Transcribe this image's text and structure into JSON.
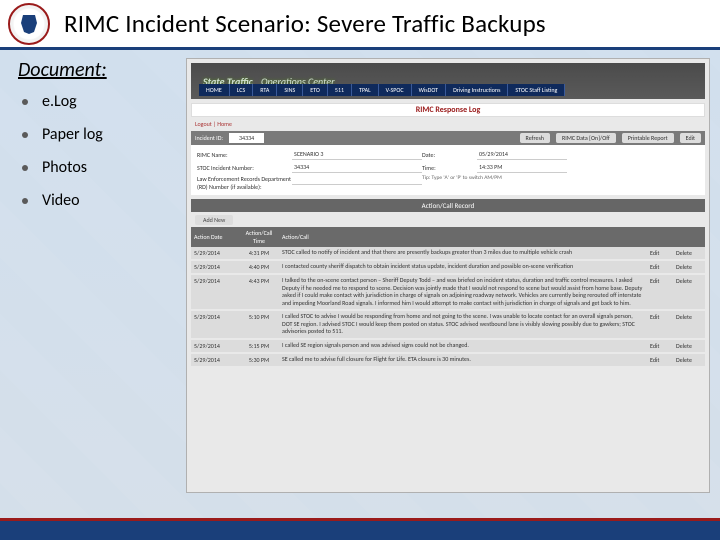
{
  "slide": {
    "title": "RIMC Incident Scenario: Severe Traffic Backups",
    "section": "Document:",
    "bullets": [
      "e.Log",
      "Paper log",
      "Photos",
      "Video"
    ]
  },
  "app": {
    "banner_main": "State Traffic",
    "banner_sub": "Operations Center",
    "nav": [
      "HOME",
      "LCS",
      "RTA",
      "SINS",
      "ETO",
      "511",
      "TPAL",
      "V-SPOC",
      "WisDOT",
      "Driving Instructions",
      "STOC Staff Listing"
    ],
    "response_label": "RIMC Response Log",
    "breadcrumb": "Logout | Home",
    "toolbar": {
      "incident_id_label": "Incident ID:",
      "incident_id": "34334",
      "refresh": "Refresh",
      "rimc_toggle": "RIMC Data [On]/Off",
      "printable": "Printable Report",
      "edit": "Edit"
    },
    "meta": {
      "rimc_name_label": "RIMC Name:",
      "rimc_name": "SCENARIO 3",
      "date_label": "Date:",
      "date": "05/29/2014",
      "stoc_label": "STOC Incident Number:",
      "stoc": "34334",
      "time_label": "Time:",
      "time": "14:33 PM",
      "le_label": "Law Enforcement Records Department (RD) Number (if available):",
      "le": "",
      "tip": "Tip: Type 'A' or 'P' to switch AM/PM"
    },
    "section_header": "Action/Call Record",
    "add_new": "Add New",
    "table": {
      "headers": [
        "Action Date",
        "Action/Call Time",
        "Action/Call",
        "",
        ""
      ],
      "rows": [
        {
          "date": "5/29/2014",
          "time": "4:31 PM",
          "text": "STOC called to notify of incident and that there are presently backups greater than 3 miles due to multiple vehicle crash",
          "a": "Edit",
          "b": "Delete"
        },
        {
          "date": "5/29/2014",
          "time": "4:40 PM",
          "text": "I contacted county sheriff dispatch to obtain incident status update, incident duration and possible on-scene verification",
          "a": "Edit",
          "b": "Delete"
        },
        {
          "date": "5/29/2014",
          "time": "4:43 PM",
          "text": "I talked to the on-scene contact person – Sheriff Deputy Todd – and was briefed on incident status, duration and traffic control measures. I asked Deputy if he needed me to respond to scene. Decision was jointly made that I would not respond to scene but would assist from home base. Deputy asked if I could make contact with jurisdiction in charge of signals on adjoining roadway network. Vehicles are currently being rerouted off interstate and impeding Moorland Road signals. I informed him I would attempt to make contact with jurisdiction in charge of signals and get back to him.",
          "a": "Edit",
          "b": "Delete"
        },
        {
          "date": "5/29/2014",
          "time": "5:10 PM",
          "text": "I called STOC to advise I would be responding from home and not going to the scene. I was unable to locate contact for an overall signals person, DOT SE region. I advised STOC I would keep them posted on status. STOC advised westbound lane is visibly slowing possibly due to gawkers; STOC advisories posted to 511.",
          "a": "Edit",
          "b": "Delete"
        },
        {
          "date": "5/29/2014",
          "time": "5:15 PM",
          "text": "I called SE region signals person and was advised signs could not be changed.",
          "a": "Edit",
          "b": "Delete"
        },
        {
          "date": "5/29/2014",
          "time": "5:30 PM",
          "text": "SE called me to advise full closure for Flight for Life. ETA closure is 30 minutes.",
          "a": "Edit",
          "b": "Delete"
        }
      ]
    }
  }
}
